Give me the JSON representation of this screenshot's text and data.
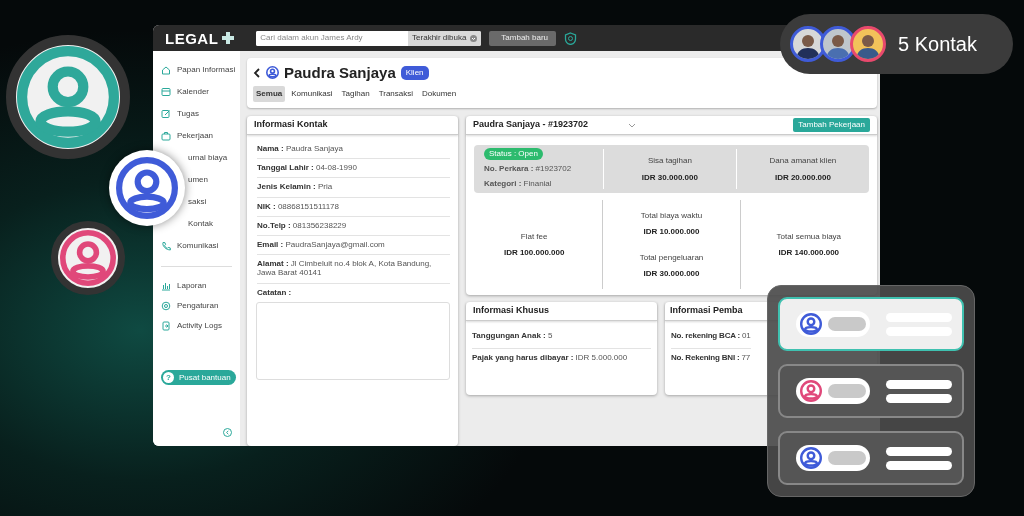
{
  "header": {
    "logo": "LEGAL",
    "search": {
      "placeholder": "Cari dalam akun James Ardy"
    },
    "filter": "Terakhir dibuka",
    "add_button": "Tambah baru"
  },
  "sidebar": {
    "items": [
      {
        "label": "Papan Informasi",
        "kind": "icon",
        "selected": false
      },
      {
        "label": "Kalender",
        "kind": "icon",
        "selected": false
      },
      {
        "label": "Tugas",
        "kind": "icon",
        "selected": false
      },
      {
        "label": "Pekerjaan",
        "kind": "icon",
        "selected": false
      },
      {
        "label": "urnal biaya",
        "kind": "covered",
        "selected": false
      },
      {
        "label": "umen",
        "kind": "covered",
        "selected": false
      },
      {
        "label": "saksi",
        "kind": "covered",
        "selected": false
      },
      {
        "label": "Kontak",
        "kind": "covered",
        "selected": false
      },
      {
        "label": "Komunikasi",
        "kind": "icon",
        "selected": false
      }
    ],
    "secondary_items": [
      {
        "label": "Laporan",
        "selected": false
      },
      {
        "label": "Pengaturan",
        "selected": false
      },
      {
        "label": "Activity Logs",
        "selected": false
      }
    ],
    "help_icon": "?",
    "help_button": "Pusat bantuan"
  },
  "client": {
    "name": "Paudra Sanjaya",
    "badge": "Klien",
    "tabs": [
      {
        "label": "Semua",
        "selected": true
      },
      {
        "label": "Komunikasi",
        "selected": false
      },
      {
        "label": "Tagihan",
        "selected": false
      },
      {
        "label": "Transaksi",
        "selected": false
      },
      {
        "label": "Dokumen",
        "selected": false
      }
    ]
  },
  "contact_info": {
    "title": "Informasi Kontak",
    "fields": [
      "**Nama :** Paudra Sanjaya",
      "**Tanggal Lahir :** 04-08-1990",
      "**Jenis Kelamin :** Pria",
      "**NIK :** 08868151511178",
      "**No.Telp :** 081356238229",
      "**Email :** PaudraSanjaya@gmail.com",
      "**Alamat :** Jl Cimbeluit no.4 blok A, Kota Bandung, Jawa Barat 40141"
    ],
    "notes_label": "Catatan :"
  },
  "case": {
    "title": "Paudra Sanjaya - #1923702",
    "button": "Tambah Pekerjaan",
    "status": "Status : Open",
    "details": [
      "**No. Perkara :** #1923702",
      "**Kategori :** Finanial"
    ],
    "summary": [
      {
        "label": "Sisa tagihan",
        "value": "IDR 30.000.000"
      },
      {
        "label": "Dana amanat klien",
        "value": "IDR 20.000.000"
      }
    ],
    "costs": [
      {
        "items": [
          {
            "label": "Flat fee",
            "value": "IDR 100.000.000"
          }
        ]
      },
      {
        "items": [
          {
            "label": "Total biaya waktu",
            "value": "IDR 10.000.000"
          },
          {
            "label": "Total pengeluaran",
            "value": "IDR 30.000.000"
          }
        ]
      },
      {
        "items": [
          {
            "label": "Total semua biaya",
            "value": "IDR 140.000.000"
          }
        ]
      }
    ]
  },
  "special_info": {
    "title": "Informasi Khusus",
    "fields": [
      "**Tanggungan Anak :** 5",
      "**Pajak yang harus dibayar :** IDR 5.000.000"
    ]
  },
  "payment_info": {
    "title": "Informasi Pemba",
    "fields": [
      "**No. rekening BCA :** 01",
      "**No. Rekening BNI :** 77"
    ]
  },
  "overlay": {
    "contacts_pill": {
      "avatars": [
        {
          "color": "#3f5bd8"
        },
        {
          "color": "#3f5bd8"
        },
        {
          "color": "#e8496d"
        }
      ],
      "label": "5 Kontak"
    },
    "avatar_badges": [
      {
        "color": "#2fa89a"
      },
      {
        "color": "#3f5bd8"
      },
      {
        "color": "#e0487a"
      }
    ],
    "contact_cards": [
      {
        "selected": true,
        "color": "#3f5bd8"
      },
      {
        "selected": false,
        "color": "#e0487a"
      },
      {
        "selected": false,
        "color": "#3f5bd8"
      }
    ]
  }
}
